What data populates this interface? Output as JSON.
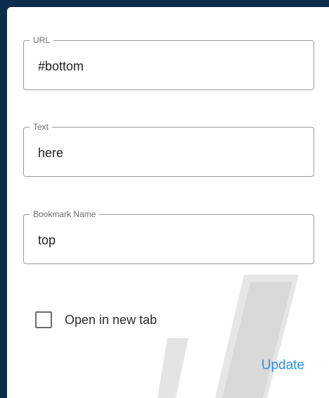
{
  "dialog": {
    "fields": [
      {
        "label": "URL",
        "value": "#bottom"
      },
      {
        "label": "Text",
        "value": "here"
      },
      {
        "label": "Bookmark Name",
        "value": "top"
      }
    ],
    "checkbox": {
      "label": "Open in new tab",
      "checked": false
    },
    "update_label": "Update"
  },
  "colors": {
    "background": "#0b2c4a",
    "panel": "#ffffff",
    "accent": "#2f8fe6",
    "border": "#9a9a9a"
  }
}
